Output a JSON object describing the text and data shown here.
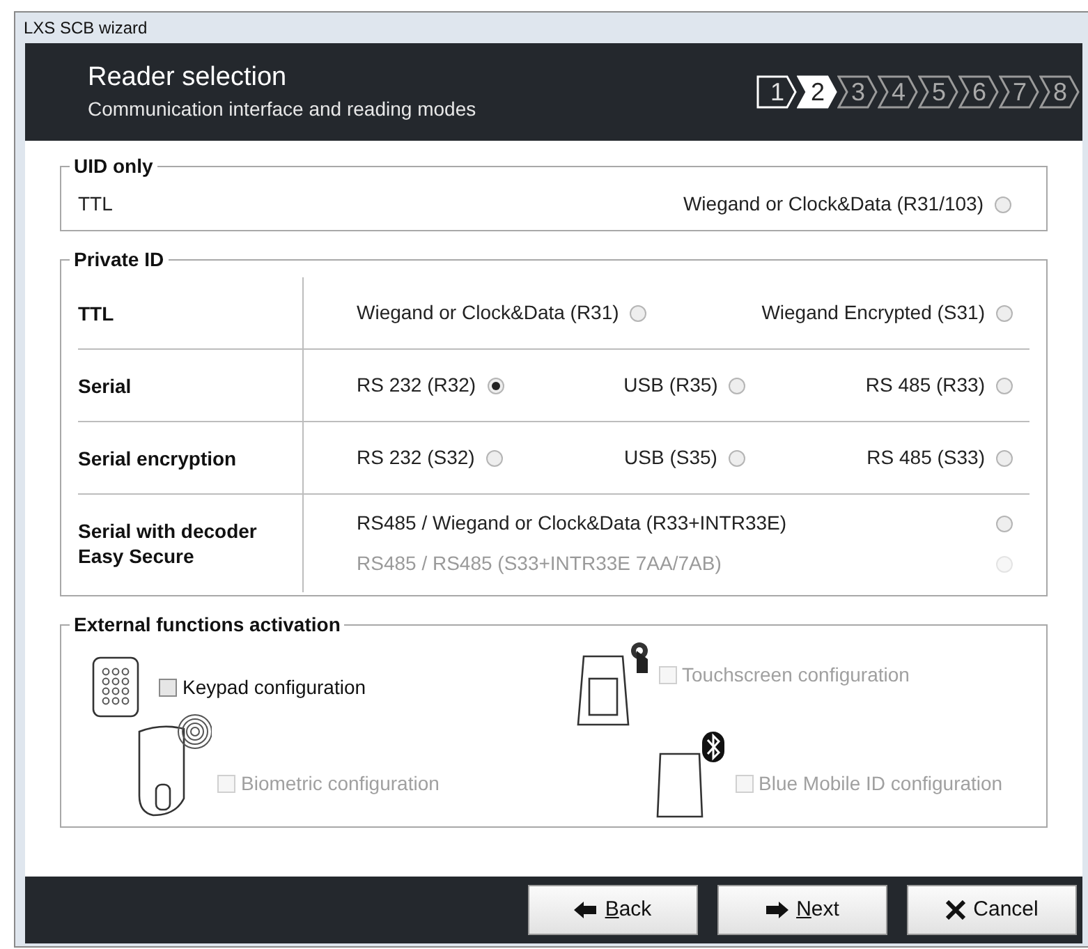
{
  "window": {
    "title": "LXS SCB wizard"
  },
  "header": {
    "title": "Reader selection",
    "subtitle": "Communication interface and reading modes"
  },
  "steps": [
    {
      "label": "1",
      "selected": false,
      "visited": true
    },
    {
      "label": "2",
      "selected": true,
      "visited": true
    },
    {
      "label": "3",
      "selected": false,
      "visited": false
    },
    {
      "label": "4",
      "selected": false,
      "visited": false
    },
    {
      "label": "5",
      "selected": false,
      "visited": false
    },
    {
      "label": "6",
      "selected": false,
      "visited": false
    },
    {
      "label": "7",
      "selected": false,
      "visited": false
    },
    {
      "label": "8",
      "selected": false,
      "visited": false
    }
  ],
  "uid_only": {
    "legend": "UID only",
    "label": "TTL",
    "option": {
      "label": "Wiegand or Clock&Data (R31/103)",
      "selected": false,
      "disabled": false
    }
  },
  "private_id": {
    "legend": "Private ID",
    "rows": [
      {
        "label": "TTL",
        "kind": "spread",
        "options": [
          {
            "label": "Wiegand or Clock&Data (R31)",
            "selected": false,
            "disabled": false
          },
          {
            "label": "Wiegand Encrypted (S31)",
            "selected": false,
            "disabled": false
          }
        ]
      },
      {
        "label": "Serial",
        "kind": "thirds",
        "options": [
          {
            "label": "RS 232 (R32)",
            "selected": true,
            "disabled": false
          },
          {
            "label": "USB (R35)",
            "selected": false,
            "disabled": false
          },
          {
            "label": "RS 485 (R33)",
            "selected": false,
            "disabled": false
          }
        ]
      },
      {
        "label": "Serial encryption",
        "kind": "thirds",
        "options": [
          {
            "label": "RS 232 (S32)",
            "selected": false,
            "disabled": false
          },
          {
            "label": "USB (S35)",
            "selected": false,
            "disabled": false
          },
          {
            "label": "RS 485 (S33)",
            "selected": false,
            "disabled": false
          }
        ]
      },
      {
        "label": "Serial with decoder\nEasy Secure",
        "kind": "stacked",
        "options": [
          {
            "label": "RS485 / Wiegand or Clock&Data (R33+INTR33E)",
            "selected": false,
            "disabled": false
          },
          {
            "label": "RS485 / RS485 (S33+INTR33E 7AA/7AB)",
            "selected": false,
            "disabled": true
          }
        ]
      }
    ]
  },
  "external": {
    "legend": "External functions activation",
    "items": [
      {
        "kind": "keypad",
        "label": "Keypad configuration",
        "checked": false,
        "disabled": false
      },
      {
        "kind": "touchscreen",
        "label": "Touchscreen configuration",
        "checked": false,
        "disabled": true
      },
      {
        "kind": "biometric",
        "label": "Biometric configuration",
        "checked": false,
        "disabled": true
      },
      {
        "kind": "bluetooth",
        "label": "Blue Mobile ID configuration",
        "checked": false,
        "disabled": true
      }
    ]
  },
  "buttons": [
    {
      "kind": "back",
      "label": "Back",
      "mnemonic": true
    },
    {
      "kind": "next",
      "label": "Next",
      "mnemonic": true
    },
    {
      "kind": "cancel",
      "label": "Cancel",
      "mnemonic": false
    }
  ]
}
